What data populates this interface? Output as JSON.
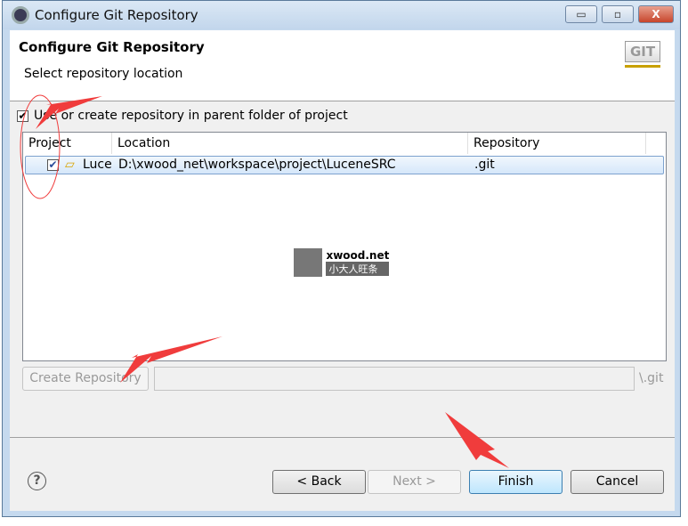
{
  "window": {
    "title": "Configure Git Repository",
    "controls": {
      "minimize": "▭",
      "maximize": "▫",
      "close": "X"
    }
  },
  "header": {
    "title": "Configure Git Repository",
    "subtitle": "Select repository location",
    "logo_text": "GIT"
  },
  "use_parent": {
    "label": "Use or create repository in parent folder of project",
    "checked": true
  },
  "table": {
    "columns": [
      "Project",
      "Location",
      "Repository"
    ],
    "rows": [
      {
        "checked": true,
        "project": "Luce",
        "location": "D:\\xwood_net\\workspace\\project\\LuceneSRC",
        "repository": ".git"
      }
    ]
  },
  "create": {
    "button": "Create Repository",
    "field_value": "",
    "suffix": "\\.git"
  },
  "watermark": {
    "text": "xwood.net",
    "subtext": "小大人旺条"
  },
  "footer": {
    "help": "?",
    "back": "< Back",
    "next": "Next >",
    "finish": "Finish",
    "cancel": "Cancel"
  },
  "colors": {
    "annotation": "#f03c3c",
    "selection": "#d5e7fa"
  }
}
